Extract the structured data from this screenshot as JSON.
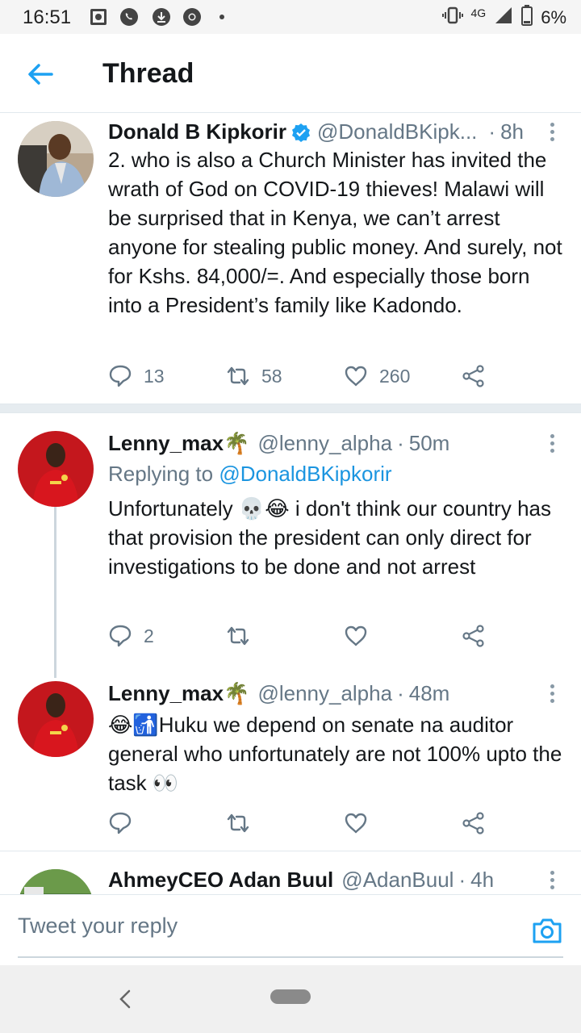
{
  "status_bar": {
    "time": "16:51",
    "network": "4G",
    "battery": "6%",
    "icons": [
      "photo-icon",
      "whatsapp-icon",
      "download-icon",
      "chrome-icon",
      "dot-icon",
      "vibrate-icon",
      "signal-icon",
      "battery-icon"
    ]
  },
  "header": {
    "title": "Thread",
    "back_icon": "arrow-left-icon"
  },
  "tweets": [
    {
      "name": "Donald B Kipkorir",
      "verified": true,
      "handle": "@DonaldBKipk...",
      "dot": "·",
      "time": "8h",
      "text": "2. who is also a Church Minister has invited the wrath of God on COVID-19 thieves! Malawi will be surprised that in Kenya, we can’t arrest anyone for stealing public money. And surely, not for Kshs. 84,000/=. And especially those born into a President’s family like Kadondo.",
      "replies": "13",
      "retweets": "58",
      "likes": "260"
    },
    {
      "name": "Lenny_max🌴",
      "handle": "@lenny_alpha",
      "dot": "·",
      "time": "50m",
      "replying_prefix": "Replying to ",
      "replying_handle": "@DonaldBKipkorir",
      "text": "Unfortunately 💀😂 i don't think our country has that provision the president can only direct for investigations to be done and not arrest",
      "replies": "2",
      "retweets": "",
      "likes": ""
    },
    {
      "name": "Lenny_max🌴",
      "handle": "@lenny_alpha",
      "dot": "·",
      "time": "48m",
      "text": "😂🚮Huku we depend on senate na auditor general who unfortunately are not 100% upto the task 👀",
      "replies": "",
      "retweets": "",
      "likes": ""
    },
    {
      "name": "AhmeyCEO Adan Buul",
      "handle": "@AdanBuul",
      "dot": "·",
      "time": "4h"
    }
  ],
  "reply_bar": {
    "placeholder": "Tweet your reply",
    "camera_icon": "camera-icon"
  },
  "nav_bar": {
    "icons": [
      "nav-back-icon",
      "home-pill-icon"
    ]
  },
  "colors": {
    "twitter_blue": "#1da1f2",
    "link_blue": "#1b95e0",
    "muted_text": "#657786",
    "divider": "#e6ecf0"
  }
}
